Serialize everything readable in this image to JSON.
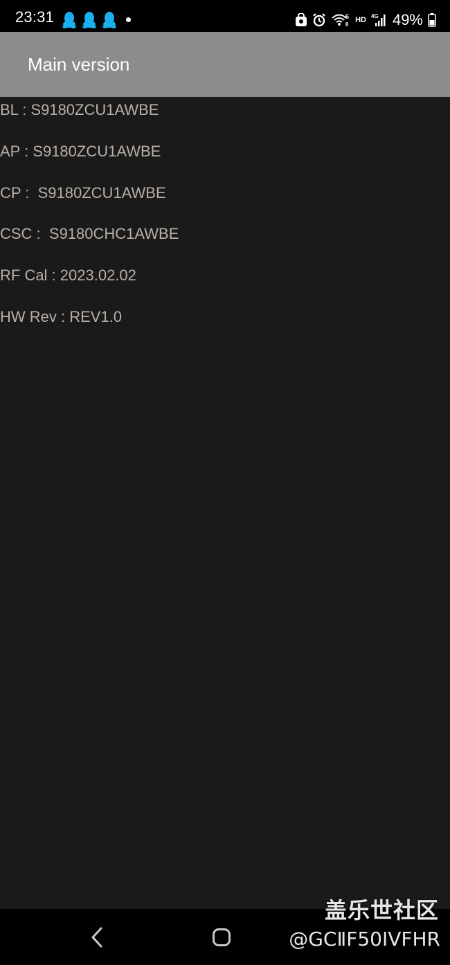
{
  "status_bar": {
    "time": "23:31",
    "notification_icons": [
      "qq-icon",
      "qq-icon",
      "qq-icon"
    ],
    "hd_label": "HD",
    "network_label": "4G",
    "battery_percent": "49%"
  },
  "app_bar": {
    "title": "Main version"
  },
  "info": [
    {
      "text": "BL : S9180ZCU1AWBE"
    },
    {
      "text": "AP : S9180ZCU1AWBE"
    },
    {
      "text": "CP :  S9180ZCU1AWBE"
    },
    {
      "text": "CSC :  S9180CHC1AWBE"
    },
    {
      "text": "RF Cal : 2023.02.02"
    },
    {
      "text": "HW Rev : REV1.0"
    }
  ],
  "watermark": {
    "title": "盖乐世社区",
    "handle": "@GCⅡF50IVFHR"
  },
  "colors": {
    "background": "#1a1a1a",
    "app_bar": "#8c8c8c",
    "info_text": "#b9afa6",
    "qq_blue": "#1ab0ee"
  }
}
